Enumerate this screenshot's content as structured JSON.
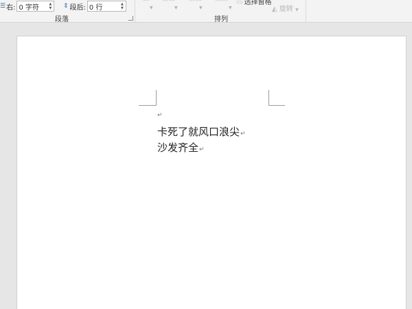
{
  "ribbon": {
    "paragraph": {
      "indent_right_label": "右:",
      "indent_right_value": "0 字符",
      "space_after_label": "段后:",
      "space_after_value": "0 行",
      "group_label": "段落"
    },
    "arrange": {
      "group_label": "排列",
      "select_pane_label": "选择窗格",
      "rotate_label": "旋转"
    }
  },
  "document": {
    "lines": [
      "卡死了就风口浪尖",
      "沙发齐全"
    ],
    "paragraph_mark": "↵"
  }
}
